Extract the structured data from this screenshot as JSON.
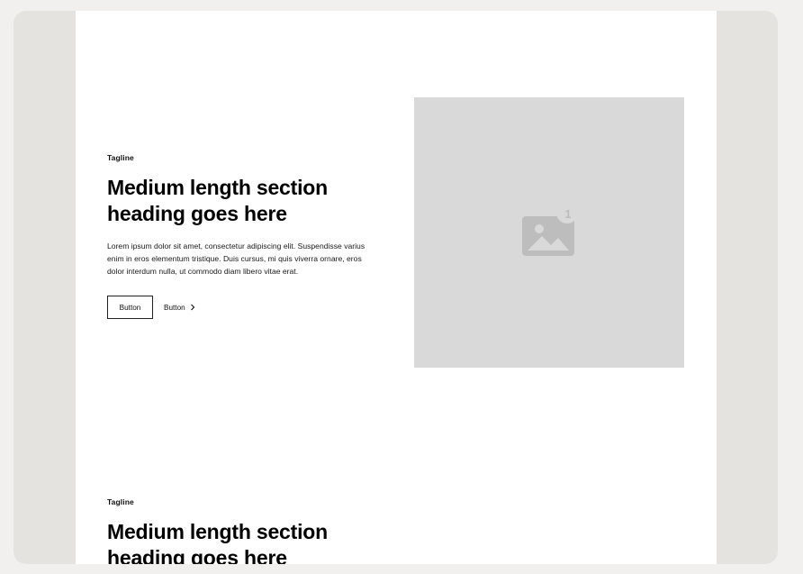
{
  "section1": {
    "tagline": "Tagline",
    "heading_line1": "Medium length section",
    "heading_line2": "heading goes here",
    "body": "Lorem ipsum dolor sit amet, consectetur adipiscing elit. Suspendisse varius enim in eros elementum tristique. Duis cursus, mi quis viverra ornare, eros dolor interdum nulla, ut commodo diam libero vitae erat.",
    "primary_button": "Button",
    "secondary_button": "Button",
    "secondary_icon": "chevron-right-icon",
    "image": {
      "icon": "image-placeholder-icon",
      "badge": "1"
    }
  },
  "section2": {
    "tagline": "Tagline",
    "heading_line1": "Medium length section",
    "heading_line2": "heading goes here"
  },
  "colors": {
    "outer_background": "#f1f0ee",
    "frame_background": "#e4e3df",
    "page_background": "#ffffff",
    "image_placeholder": "#d9d9d9",
    "icon": "#bdbdbd"
  }
}
